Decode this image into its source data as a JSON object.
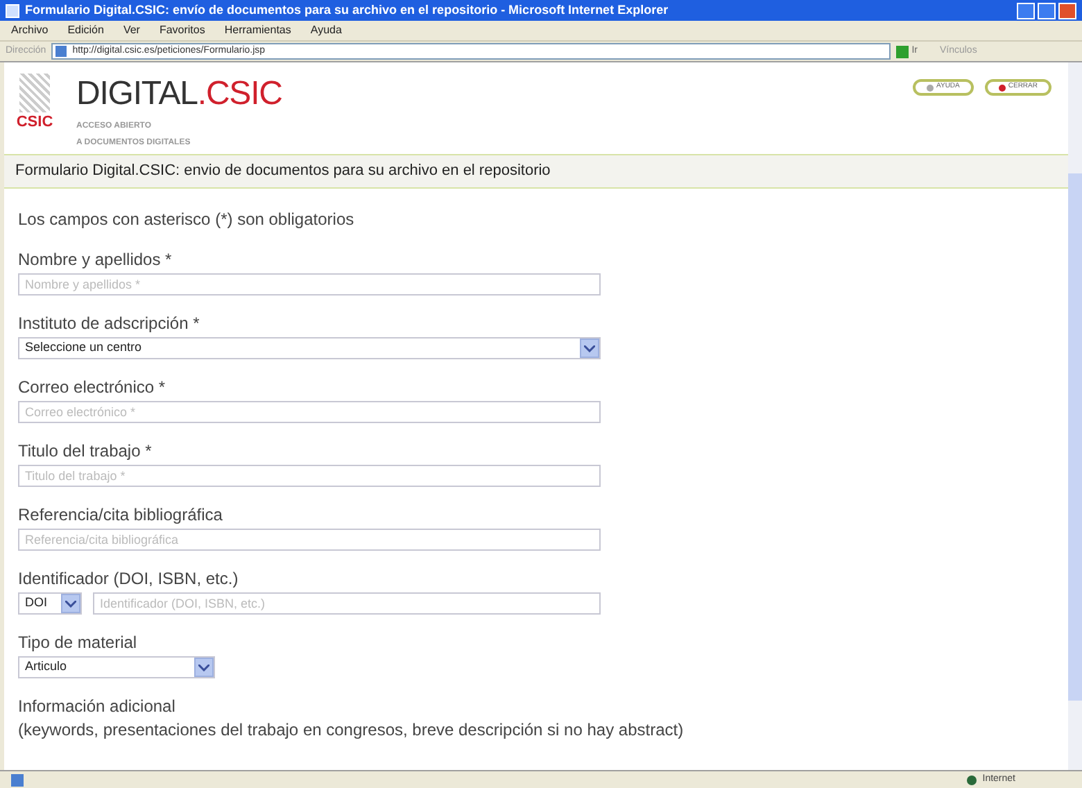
{
  "window": {
    "title": "Formulario Digital.CSIC: envío de documentos para su archivo en el repositorio - Microsoft Internet Explorer"
  },
  "menu": [
    "Archivo",
    "Edición",
    "Ver",
    "Favoritos",
    "Herramientas",
    "Ayuda"
  ],
  "address_bar": {
    "label": "Dirección",
    "url": "http://digital.csic.es/peticiones/Formulario.jsp",
    "go": "Ir",
    "links": "Vínculos"
  },
  "site_header": {
    "brand_main": "DIGITAL",
    "brand_accent": ".CSIC",
    "tagline_1": "ACCESO ABIERTO",
    "tagline_2": "A DOCUMENTOS DIGITALES",
    "logo_text": "CSIC",
    "buttons": [
      {
        "label": "AYUDA",
        "kind": "help"
      },
      {
        "label": "CERRAR",
        "kind": "close"
      }
    ]
  },
  "page_title": "Formulario Digital.CSIC: envio de documentos para su archivo en el repositorio",
  "note": "Los campos con asterisco (*) son obligatorios",
  "fields": [
    {
      "kind": "text",
      "label": "Nombre y apellidos *",
      "placeholder": "Nombre y apellidos *"
    },
    {
      "kind": "select",
      "label": "Instituto de adscripción *",
      "value": "Seleccione un centro"
    },
    {
      "kind": "text",
      "label": "Correo electrónico *",
      "placeholder": "Correo electrónico *"
    },
    {
      "kind": "text",
      "label": "Titulo del trabajo *",
      "placeholder": "Titulo del trabajo *"
    },
    {
      "kind": "text",
      "label": "Referencia/cita bibliográfica",
      "placeholder": "Referencia/cita bibliográfica"
    },
    {
      "kind": "combo",
      "label": "Identificador (DOI, ISBN, etc.)",
      "value": "DOI",
      "placeholder": "Identificador (DOI, ISBN, etc.)"
    },
    {
      "kind": "short_select",
      "label": "Tipo de material",
      "value": "Articulo"
    },
    {
      "kind": "note",
      "label": "Información adicional",
      "hint": "(keywords, presentaciones del trabajo en congresos, breve descripción si no hay abstract)"
    }
  ],
  "status_bar": {
    "zone": "Internet"
  }
}
